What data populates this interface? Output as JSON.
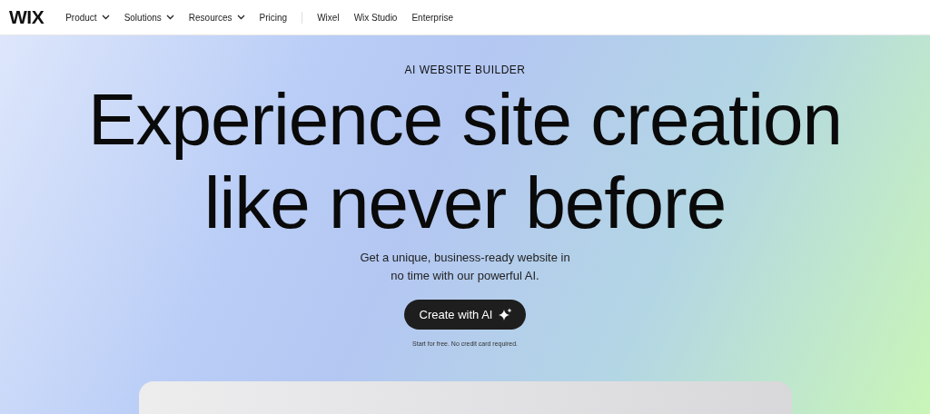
{
  "header": {
    "logo": "WIX",
    "nav_groups": [
      [
        {
          "label": "Product",
          "dropdown": true
        },
        {
          "label": "Solutions",
          "dropdown": true
        },
        {
          "label": "Resources",
          "dropdown": true
        },
        {
          "label": "Pricing",
          "dropdown": false
        }
      ],
      [
        {
          "label": "Wixel",
          "dropdown": false
        },
        {
          "label": "Wix Studio",
          "dropdown": false
        },
        {
          "label": "Enterprise",
          "dropdown": false
        }
      ]
    ]
  },
  "hero": {
    "eyebrow": "AI WEBSITE BUILDER",
    "headline": [
      "Experience site creation",
      "like never before"
    ],
    "subtitle": "Get a unique, business-ready website in no time with our powerful AI.",
    "cta": "Create with AI",
    "note": "Start for free. No credit card required."
  }
}
